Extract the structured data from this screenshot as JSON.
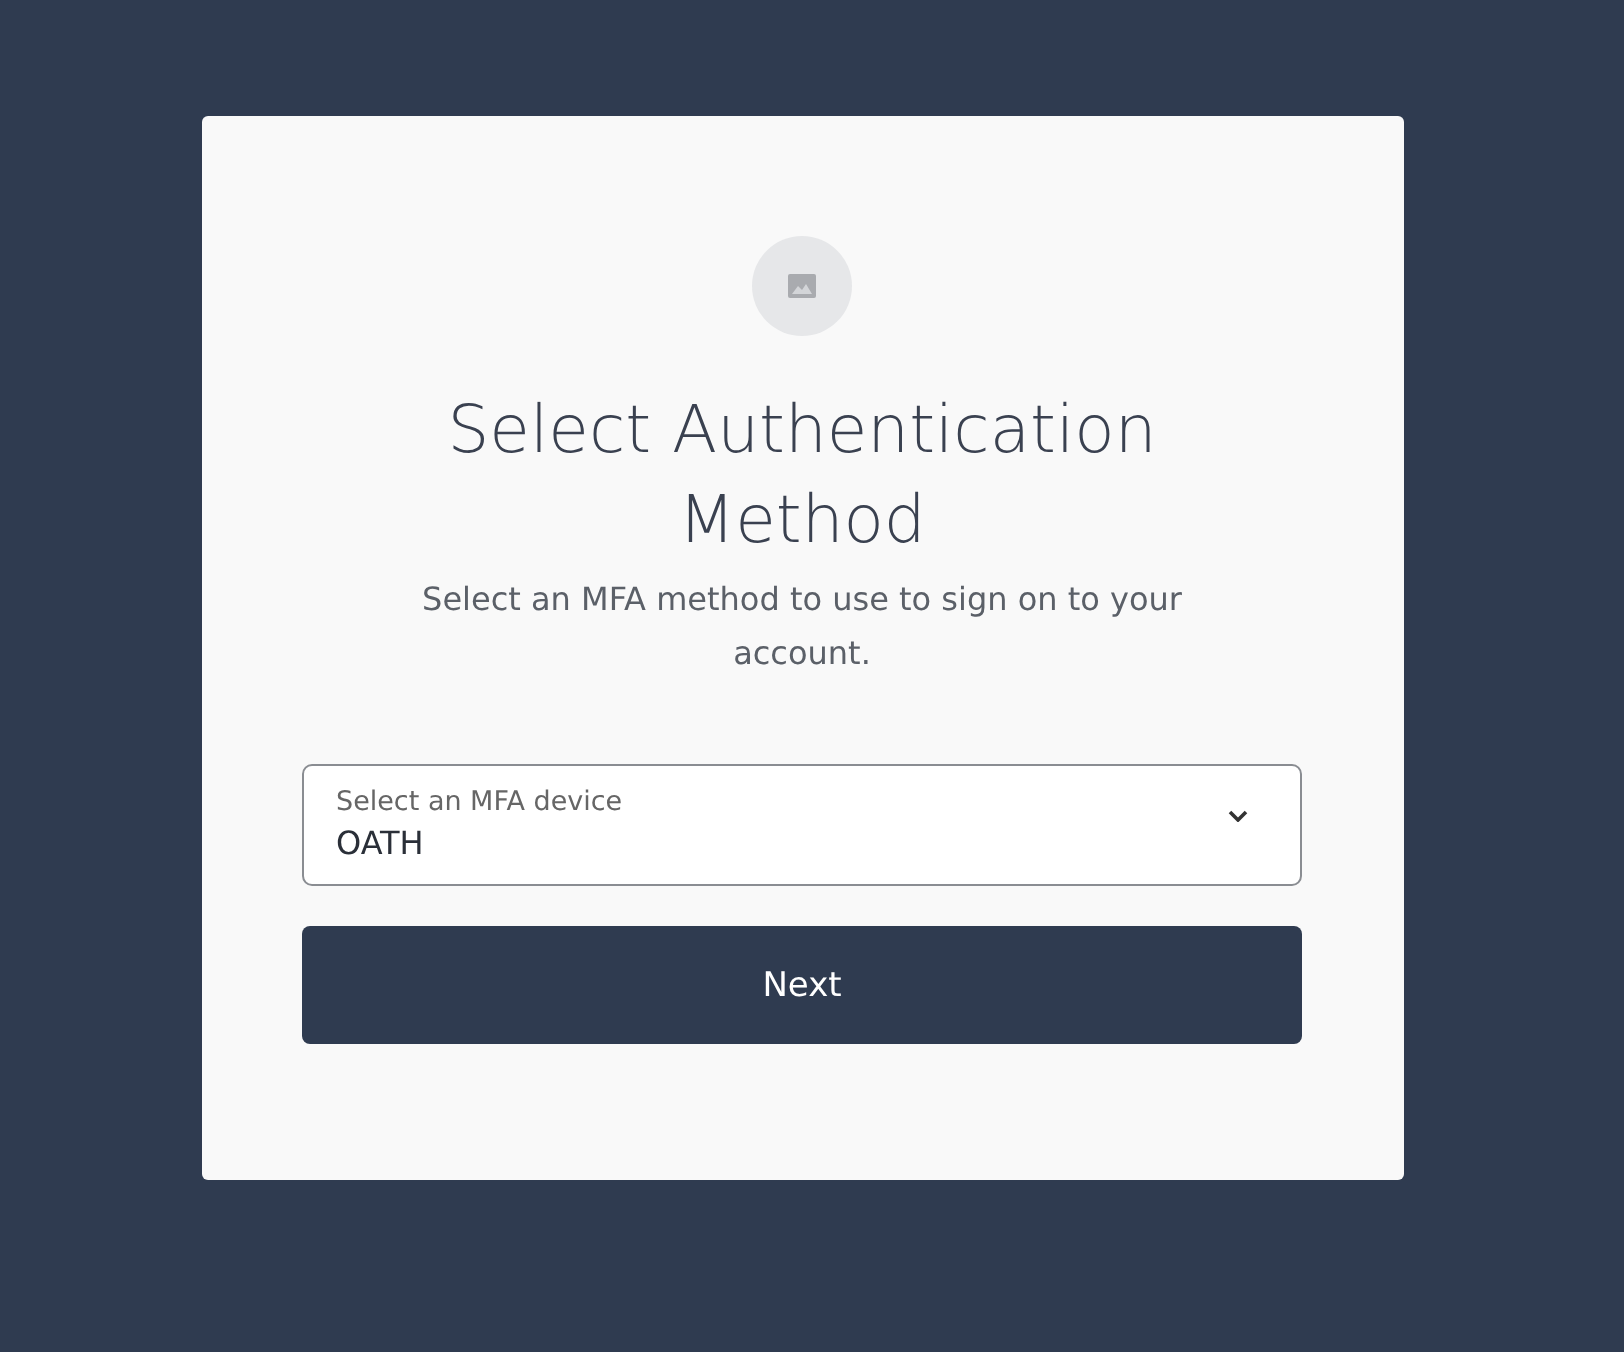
{
  "title": "Select Authentication Method",
  "subtitle": "Select an MFA method to use to sign on to your account.",
  "device_select": {
    "label": "Select an MFA device",
    "value": "OATH"
  },
  "buttons": [
    "Next"
  ]
}
